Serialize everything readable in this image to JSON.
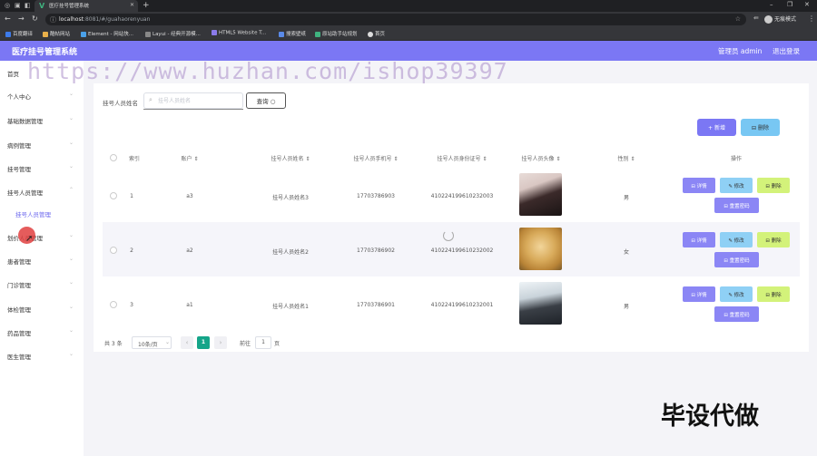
{
  "browser": {
    "tab_title": "医疗挂号管理系统",
    "url_host": "localhost",
    "url_rest": ":8081/#/guahaorenyuan",
    "profile_label": "无痕模式",
    "bookmarks": [
      "百度翻译",
      "酷帖网站",
      "Element - 网站快...",
      "Layui - 经典开源模...",
      "HTML5 Website T...",
      "搜索壁纸",
      "原站助手站规划",
      "首页"
    ]
  },
  "header": {
    "title": "医疗挂号管理系统",
    "admin": "管理员 admin",
    "logout": "退出登录"
  },
  "watermark": "https://www.huzhan.com/ishop39397",
  "sidebar": {
    "items": [
      {
        "label": "首页"
      },
      {
        "label": "个人中心"
      },
      {
        "label": "基础数据管理"
      },
      {
        "label": "病例管理"
      },
      {
        "label": "挂号管理"
      },
      {
        "label": "挂号人员管理"
      },
      {
        "label": "划价人员管理"
      },
      {
        "label": "患者管理"
      },
      {
        "label": "门诊管理"
      },
      {
        "label": "体检管理"
      },
      {
        "label": "药品管理"
      },
      {
        "label": "医生管理"
      }
    ],
    "sub_item": "挂号人员管理"
  },
  "search": {
    "label": "挂号人员姓名",
    "placeholder": "挂号人员姓名",
    "button": "查询 ○"
  },
  "toolbar": {
    "add": "+ 新增",
    "delete": "⊟ 删除"
  },
  "table": {
    "headers": [
      "索引",
      "账户 ⇕",
      "挂号人员姓名 ⇕",
      "挂号人员手机号 ⇕",
      "挂号人员身份证号 ⇕",
      "挂号人员头像 ⇕",
      "性别 ⇕",
      "操作"
    ],
    "rows": [
      {
        "index": "1",
        "account": "a3",
        "name": "挂号人员姓名3",
        "phone": "17703786903",
        "idcard": "410224199610232003",
        "avatar": "girl-photo",
        "gender": "男"
      },
      {
        "index": "2",
        "account": "a2",
        "name": "挂号人员姓名2",
        "phone": "17703786902",
        "idcard": "410224199610232002",
        "avatar": "dog-photo",
        "gender": "女"
      },
      {
        "index": "3",
        "account": "a1",
        "name": "挂号人员姓名1",
        "phone": "17703786901",
        "idcard": "410224199610232001",
        "avatar": "boy-photo",
        "gender": "男"
      }
    ],
    "ops": {
      "detail": "⊟ 详情",
      "edit": "✎ 修改",
      "delete": "⊟ 删除",
      "reset": "⊟ 重置密码"
    }
  },
  "pager": {
    "total": "共 3 条",
    "size": "10条/页",
    "page": "1",
    "goto_label": "前往",
    "goto_value": "1",
    "goto_suffix": "页"
  },
  "corner_text": "毕设代做",
  "colors": {
    "accent": "#7b77f4",
    "page_active": "#15a589",
    "edit": "#8fd0f5",
    "delete": "#d3f27a"
  }
}
